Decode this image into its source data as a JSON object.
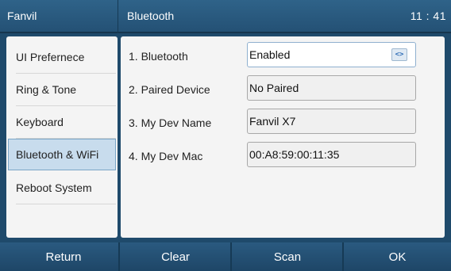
{
  "header": {
    "brand": "Fanvil",
    "title": "Bluetooth",
    "clock": "11 : 41"
  },
  "sidebar": {
    "items": [
      {
        "label": "UI Prefernece"
      },
      {
        "label": "Ring & Tone"
      },
      {
        "label": "Keyboard"
      },
      {
        "label": "Bluetooth & WiFi",
        "selected": true
      },
      {
        "label": "Reboot System"
      }
    ]
  },
  "settings": {
    "rows": [
      {
        "label": "1. Bluetooth",
        "value": "Enabled",
        "control": "select",
        "control_icon": "<>"
      },
      {
        "label": "2. Paired Device",
        "value": "No Paired",
        "control": "readonly"
      },
      {
        "label": "3. My Dev Name",
        "value": "Fanvil X7",
        "control": "input"
      },
      {
        "label": "4. My Dev Mac",
        "value": "00:A8:59:00:11:35",
        "control": "readonly"
      }
    ]
  },
  "softkeys": {
    "return": "Return",
    "clear": "Clear",
    "scan": "Scan",
    "ok": "OK"
  },
  "colors": {
    "header_bg": "#2f6389",
    "selected_item_bg": "#c8dced",
    "panel_bg": "#f4f4f4"
  }
}
